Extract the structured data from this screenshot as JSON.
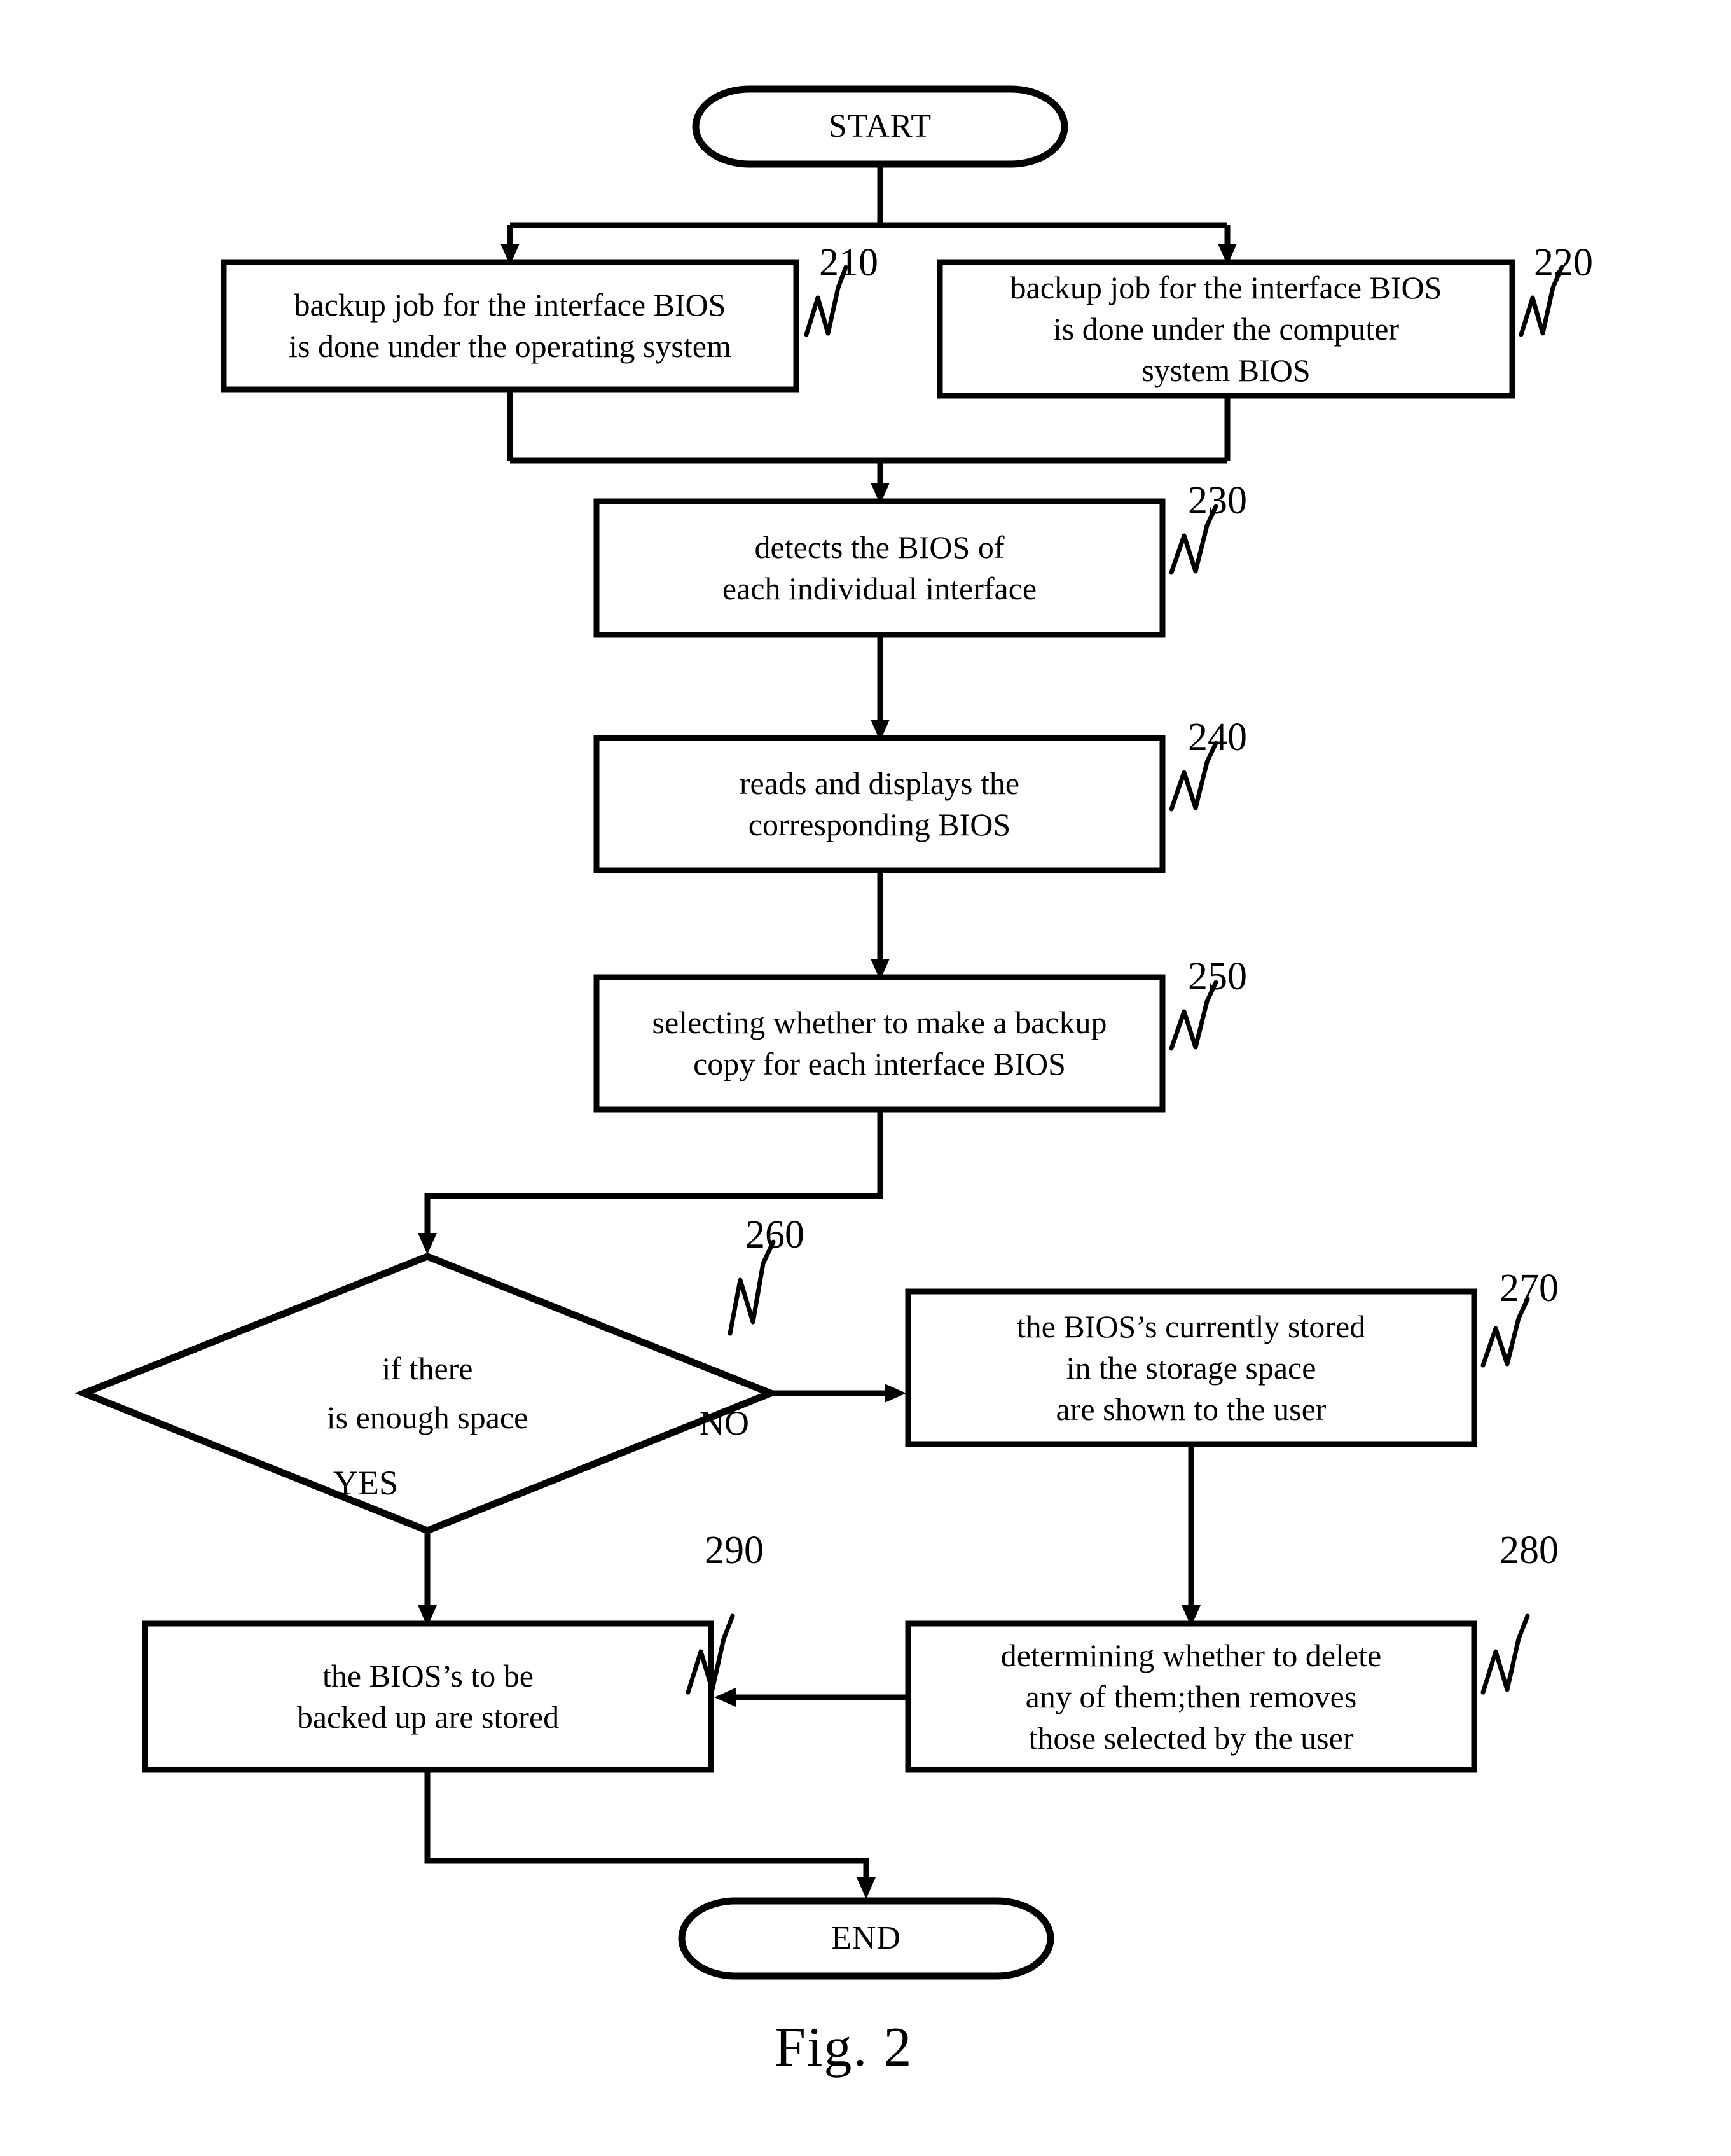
{
  "figure": {
    "caption": "Fig. 2"
  },
  "nodes": {
    "start": {
      "id": "start",
      "shape": "terminal",
      "lines": [
        "START"
      ]
    },
    "n210": {
      "id": "210",
      "shape": "process",
      "ref": "210",
      "lines": [
        "backup job for the interface BIOS",
        "is done under the operating system"
      ]
    },
    "n220": {
      "id": "220",
      "shape": "process",
      "ref": "220",
      "lines": [
        "backup job for the interface BIOS",
        "is done under the computer",
        "system BIOS"
      ]
    },
    "n230": {
      "id": "230",
      "shape": "process",
      "ref": "230",
      "lines": [
        "detects the BIOS of",
        "each individual interface"
      ]
    },
    "n240": {
      "id": "240",
      "shape": "process",
      "ref": "240",
      "lines": [
        "reads and displays the",
        "corresponding BIOS"
      ]
    },
    "n250": {
      "id": "250",
      "shape": "process",
      "ref": "250",
      "lines": [
        "selecting whether to make a backup",
        "copy for each interface BIOS"
      ]
    },
    "n260": {
      "id": "260",
      "shape": "decision",
      "ref": "260",
      "lines": [
        "if there",
        "is enough space"
      ]
    },
    "n270": {
      "id": "270",
      "shape": "process",
      "ref": "270",
      "lines": [
        "the BIOS’s currently stored",
        "in the storage space",
        "are shown to the user"
      ]
    },
    "n280": {
      "id": "280",
      "shape": "process",
      "ref": "280",
      "lines": [
        "determining whether to delete",
        "any of them;then removes",
        "those selected by the user"
      ]
    },
    "n290": {
      "id": "290",
      "shape": "process",
      "ref": "290",
      "lines": [
        "the BIOS’s to be",
        "backed up are stored"
      ]
    },
    "end": {
      "id": "end",
      "shape": "terminal",
      "lines": [
        "END"
      ]
    }
  },
  "edge_labels": {
    "yes": "YES",
    "no": "NO"
  },
  "refs": {
    "r210": "210",
    "r220": "220",
    "r230": "230",
    "r240": "240",
    "r250": "250",
    "r260": "260",
    "r270": "270",
    "r280": "280",
    "r290": "290"
  },
  "colors": {
    "stroke": "#000000",
    "fill": "#ffffff",
    "background": "#ffffff"
  }
}
